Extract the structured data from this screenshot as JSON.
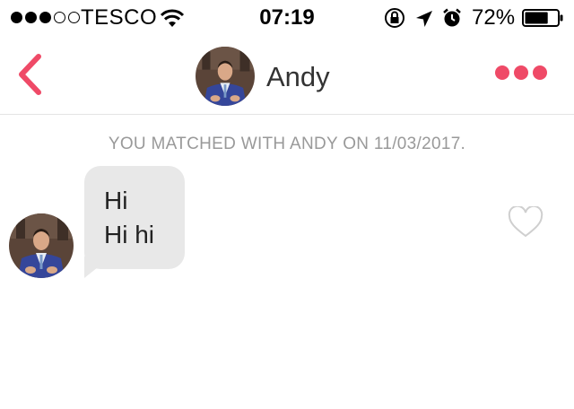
{
  "status_bar": {
    "carrier": "TESCO",
    "time": "07:19",
    "battery_percent": "72%",
    "battery_level": 0.72,
    "signal_bars": 3,
    "signal_total": 5
  },
  "nav": {
    "back_icon": "chevron-left-icon",
    "contact_name": "Andy",
    "more_icon": "more-dots-icon",
    "accent_color": "#ef4a67"
  },
  "conversation": {
    "match_note": "YOU MATCHED WITH ANDY ON 11/03/2017.",
    "messages": [
      {
        "lines": [
          "Hi",
          "Hi hi"
        ],
        "liked": false
      }
    ]
  }
}
